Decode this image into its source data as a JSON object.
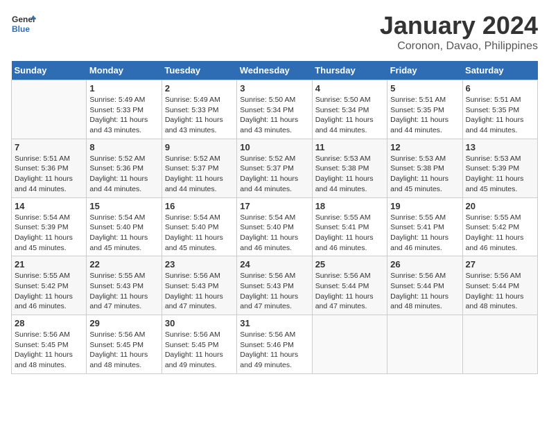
{
  "logo": {
    "line1": "General",
    "line2": "Blue"
  },
  "title": "January 2024",
  "subtitle": "Coronon, Davao, Philippines",
  "days_header": [
    "Sunday",
    "Monday",
    "Tuesday",
    "Wednesday",
    "Thursday",
    "Friday",
    "Saturday"
  ],
  "weeks": [
    [
      {
        "day": "",
        "info": ""
      },
      {
        "day": "1",
        "info": "Sunrise: 5:49 AM\nSunset: 5:33 PM\nDaylight: 11 hours\nand 43 minutes."
      },
      {
        "day": "2",
        "info": "Sunrise: 5:49 AM\nSunset: 5:33 PM\nDaylight: 11 hours\nand 43 minutes."
      },
      {
        "day": "3",
        "info": "Sunrise: 5:50 AM\nSunset: 5:34 PM\nDaylight: 11 hours\nand 43 minutes."
      },
      {
        "day": "4",
        "info": "Sunrise: 5:50 AM\nSunset: 5:34 PM\nDaylight: 11 hours\nand 44 minutes."
      },
      {
        "day": "5",
        "info": "Sunrise: 5:51 AM\nSunset: 5:35 PM\nDaylight: 11 hours\nand 44 minutes."
      },
      {
        "day": "6",
        "info": "Sunrise: 5:51 AM\nSunset: 5:35 PM\nDaylight: 11 hours\nand 44 minutes."
      }
    ],
    [
      {
        "day": "7",
        "info": "Sunrise: 5:51 AM\nSunset: 5:36 PM\nDaylight: 11 hours\nand 44 minutes."
      },
      {
        "day": "8",
        "info": "Sunrise: 5:52 AM\nSunset: 5:36 PM\nDaylight: 11 hours\nand 44 minutes."
      },
      {
        "day": "9",
        "info": "Sunrise: 5:52 AM\nSunset: 5:37 PM\nDaylight: 11 hours\nand 44 minutes."
      },
      {
        "day": "10",
        "info": "Sunrise: 5:52 AM\nSunset: 5:37 PM\nDaylight: 11 hours\nand 44 minutes."
      },
      {
        "day": "11",
        "info": "Sunrise: 5:53 AM\nSunset: 5:38 PM\nDaylight: 11 hours\nand 44 minutes."
      },
      {
        "day": "12",
        "info": "Sunrise: 5:53 AM\nSunset: 5:38 PM\nDaylight: 11 hours\nand 45 minutes."
      },
      {
        "day": "13",
        "info": "Sunrise: 5:53 AM\nSunset: 5:39 PM\nDaylight: 11 hours\nand 45 minutes."
      }
    ],
    [
      {
        "day": "14",
        "info": "Sunrise: 5:54 AM\nSunset: 5:39 PM\nDaylight: 11 hours\nand 45 minutes."
      },
      {
        "day": "15",
        "info": "Sunrise: 5:54 AM\nSunset: 5:40 PM\nDaylight: 11 hours\nand 45 minutes."
      },
      {
        "day": "16",
        "info": "Sunrise: 5:54 AM\nSunset: 5:40 PM\nDaylight: 11 hours\nand 45 minutes."
      },
      {
        "day": "17",
        "info": "Sunrise: 5:54 AM\nSunset: 5:40 PM\nDaylight: 11 hours\nand 46 minutes."
      },
      {
        "day": "18",
        "info": "Sunrise: 5:55 AM\nSunset: 5:41 PM\nDaylight: 11 hours\nand 46 minutes."
      },
      {
        "day": "19",
        "info": "Sunrise: 5:55 AM\nSunset: 5:41 PM\nDaylight: 11 hours\nand 46 minutes."
      },
      {
        "day": "20",
        "info": "Sunrise: 5:55 AM\nSunset: 5:42 PM\nDaylight: 11 hours\nand 46 minutes."
      }
    ],
    [
      {
        "day": "21",
        "info": "Sunrise: 5:55 AM\nSunset: 5:42 PM\nDaylight: 11 hours\nand 46 minutes."
      },
      {
        "day": "22",
        "info": "Sunrise: 5:55 AM\nSunset: 5:43 PM\nDaylight: 11 hours\nand 47 minutes."
      },
      {
        "day": "23",
        "info": "Sunrise: 5:56 AM\nSunset: 5:43 PM\nDaylight: 11 hours\nand 47 minutes."
      },
      {
        "day": "24",
        "info": "Sunrise: 5:56 AM\nSunset: 5:43 PM\nDaylight: 11 hours\nand 47 minutes."
      },
      {
        "day": "25",
        "info": "Sunrise: 5:56 AM\nSunset: 5:44 PM\nDaylight: 11 hours\nand 47 minutes."
      },
      {
        "day": "26",
        "info": "Sunrise: 5:56 AM\nSunset: 5:44 PM\nDaylight: 11 hours\nand 48 minutes."
      },
      {
        "day": "27",
        "info": "Sunrise: 5:56 AM\nSunset: 5:44 PM\nDaylight: 11 hours\nand 48 minutes."
      }
    ],
    [
      {
        "day": "28",
        "info": "Sunrise: 5:56 AM\nSunset: 5:45 PM\nDaylight: 11 hours\nand 48 minutes."
      },
      {
        "day": "29",
        "info": "Sunrise: 5:56 AM\nSunset: 5:45 PM\nDaylight: 11 hours\nand 48 minutes."
      },
      {
        "day": "30",
        "info": "Sunrise: 5:56 AM\nSunset: 5:45 PM\nDaylight: 11 hours\nand 49 minutes."
      },
      {
        "day": "31",
        "info": "Sunrise: 5:56 AM\nSunset: 5:46 PM\nDaylight: 11 hours\nand 49 minutes."
      },
      {
        "day": "",
        "info": ""
      },
      {
        "day": "",
        "info": ""
      },
      {
        "day": "",
        "info": ""
      }
    ]
  ]
}
